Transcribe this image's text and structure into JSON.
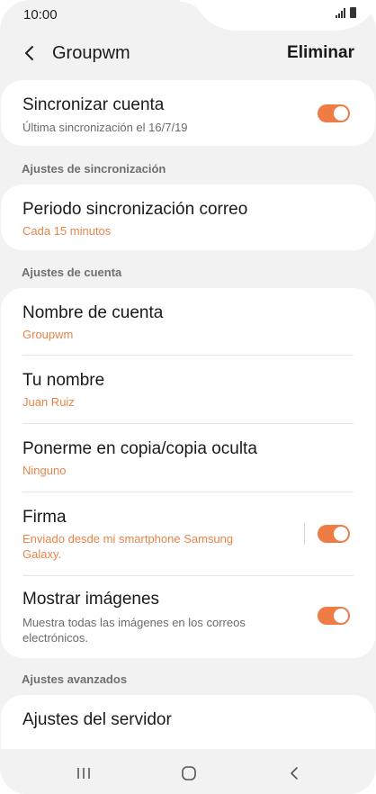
{
  "status_bar": {
    "time": "10:00"
  },
  "header": {
    "title": "Groupwm",
    "delete_label": "Eliminar"
  },
  "account_card": {
    "title": "Sincronizar cuenta",
    "subtitle": "Última sincronización el 16/7/19",
    "toggle_on": true
  },
  "sections": {
    "sync": "Ajustes de sincronización",
    "account": "Ajustes de cuenta",
    "advanced": "Ajustes avanzados"
  },
  "sync_settings": {
    "period_title": "Periodo sincronización correo",
    "period_value": "Cada 15 minutos"
  },
  "account_settings": {
    "account_name_title": "Nombre de cuenta",
    "account_name_value": "Groupwm",
    "your_name_title": "Tu nombre",
    "your_name_value": "Juan Ruiz",
    "cc_title": "Ponerme en copia/copia oculta",
    "cc_value": "Ninguno",
    "signature_title": "Firma",
    "signature_value": "Enviado desde mi smartphone Samsung Galaxy.",
    "signature_toggle_on": true,
    "images_title": "Mostrar imágenes",
    "images_subtitle": "Muestra todas las imágenes en los correos electrónicos.",
    "images_toggle_on": true
  },
  "advanced_settings": {
    "server_title": "Ajustes del servidor"
  },
  "accent_color": "#f07c45",
  "icons": {
    "back": "chevron-left-icon",
    "recents": "recent-apps-icon",
    "home": "home-icon",
    "nav_back": "nav-back-icon"
  }
}
